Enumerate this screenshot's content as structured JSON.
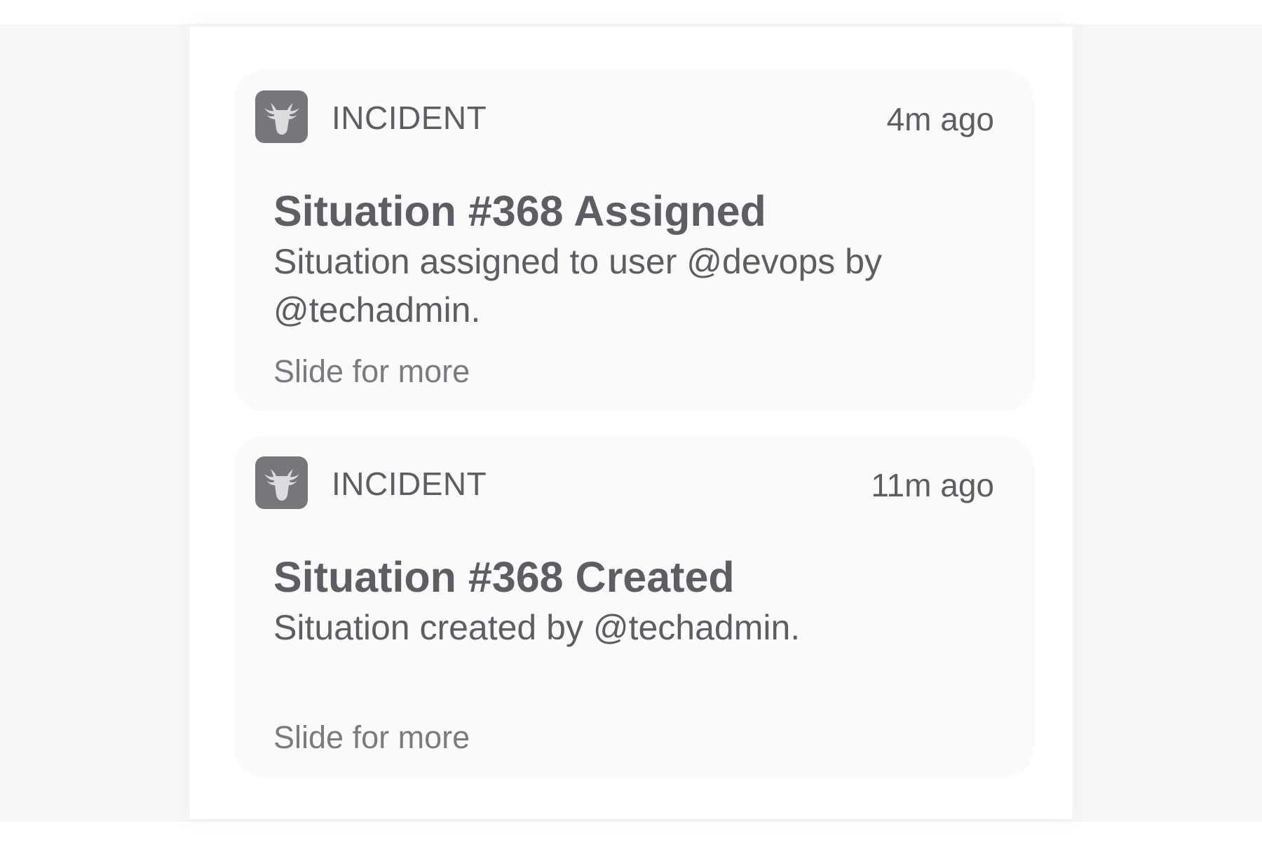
{
  "notifications": [
    {
      "app_name": "INCIDENT",
      "app_icon": "bull-head-icon",
      "time": "4m ago",
      "title": "Situation #368 Assigned",
      "body": "Situation assigned to user @devops by @techadmin.",
      "action_hint": "Slide for more"
    },
    {
      "app_name": "INCIDENT",
      "app_icon": "bull-head-icon",
      "time": "11m ago",
      "title": "Situation #368 Created",
      "body": "Situation created by @techadmin.",
      "action_hint": "Slide for more"
    }
  ],
  "colors": {
    "icon_background": "#76767b",
    "icon_glyph": "#dcdcdf",
    "text": "#5d5d63",
    "card_background": "#fafafa"
  }
}
